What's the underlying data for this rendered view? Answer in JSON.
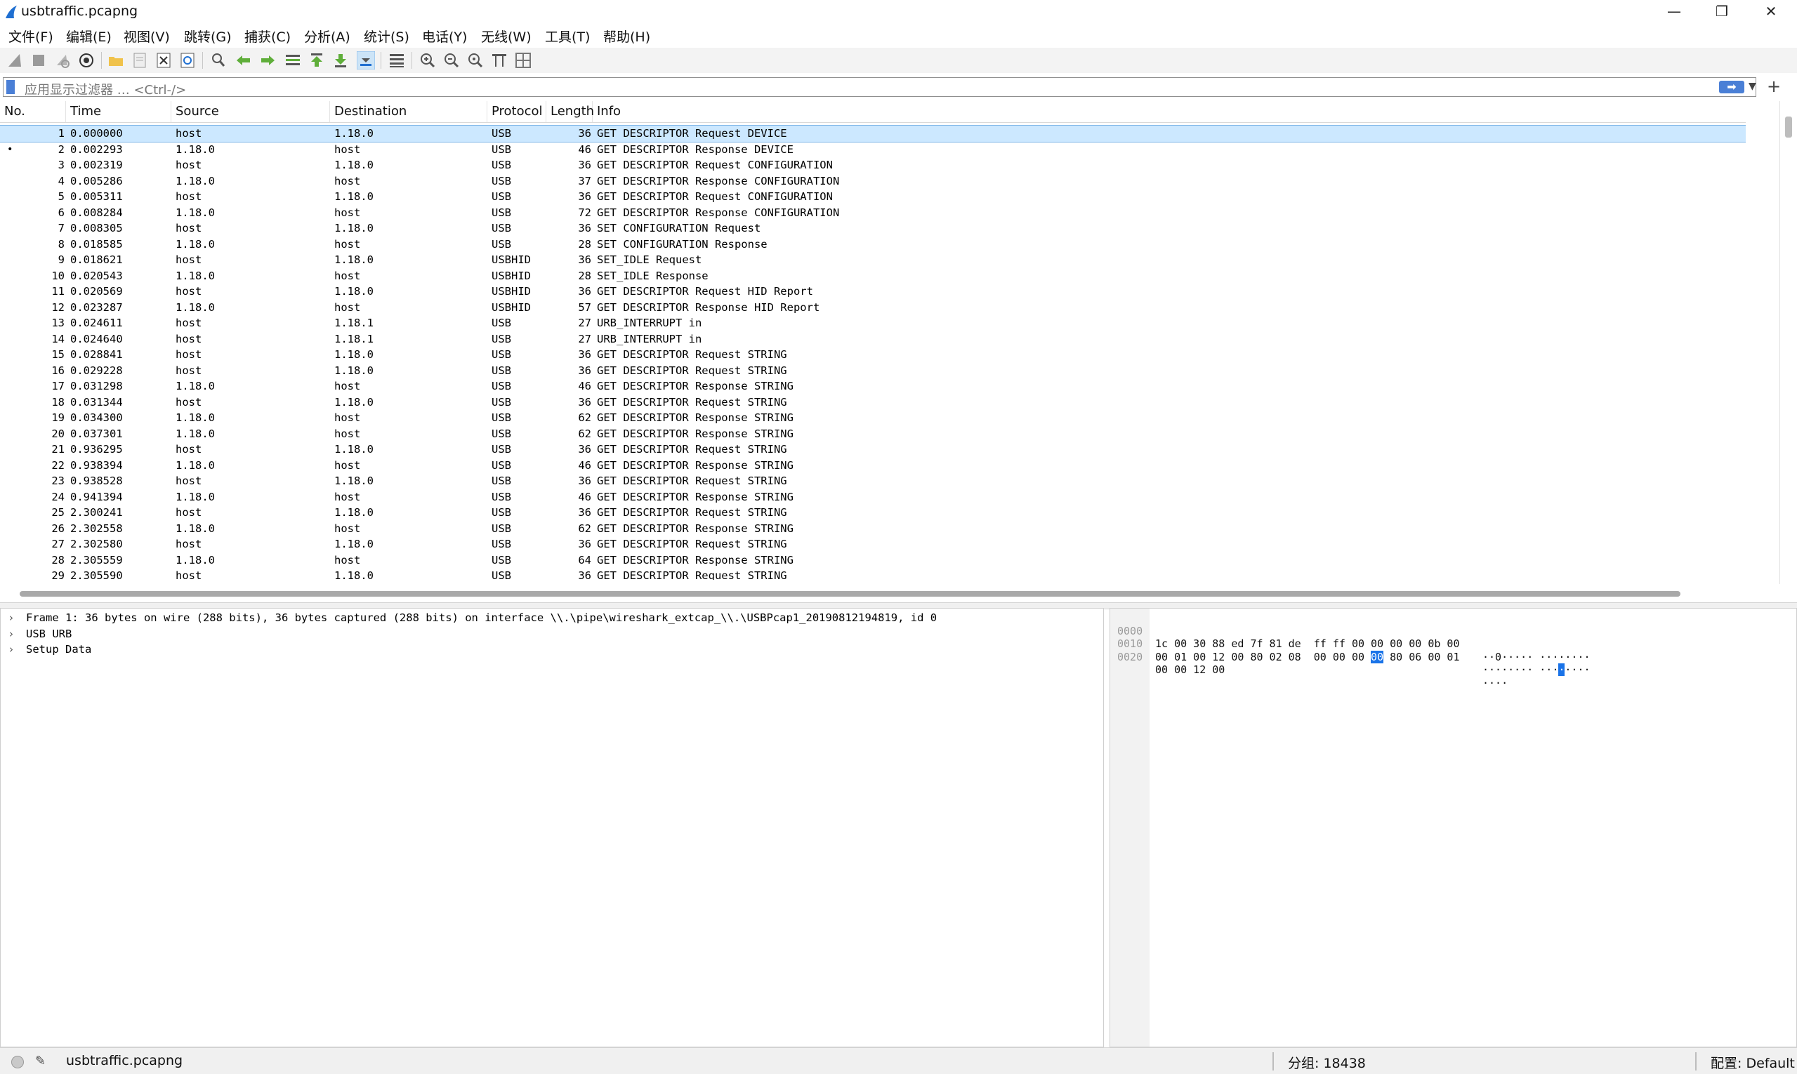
{
  "window": {
    "title": "usbtraffic.pcapng"
  },
  "menu": [
    "文件(F)",
    "编辑(E)",
    "视图(V)",
    "跳转(G)",
    "捕获(C)",
    "分析(A)",
    "统计(S)",
    "电话(Y)",
    "无线(W)",
    "工具(T)",
    "帮助(H)"
  ],
  "toolbar": {
    "icons": [
      "start-capture-icon",
      "stop-capture-icon",
      "restart-capture-icon",
      "capture-options-icon",
      "open-file-icon",
      "save-file-icon",
      "close-file-icon",
      "reload-file-icon",
      "find-packet-icon",
      "go-back-icon",
      "go-forward-icon",
      "go-to-packet-icon",
      "first-packet-icon",
      "last-packet-icon",
      "autoscroll-icon",
      "colorize-icon",
      "zoom-in-icon",
      "zoom-out-icon",
      "zoom-normal-icon",
      "resize-columns-icon",
      "layout-icon"
    ]
  },
  "filter": {
    "placeholder": "应用显示过滤器 … <Ctrl-/>",
    "apply_label": "➡",
    "add_label": "+"
  },
  "packet_list": {
    "columns": [
      "No.",
      "Time",
      "Source",
      "Destination",
      "Protocol",
      "Length",
      "Info"
    ],
    "selected_index": 0,
    "rows": [
      {
        "no": "1",
        "time": "0.000000",
        "src": "host",
        "dst": "1.18.0",
        "proto": "USB",
        "len": "36",
        "info": "GET DESCRIPTOR Request DEVICE"
      },
      {
        "no": "2",
        "time": "0.002293",
        "src": "1.18.0",
        "dst": "host",
        "proto": "USB",
        "len": "46",
        "info": "GET DESCRIPTOR Response DEVICE"
      },
      {
        "no": "3",
        "time": "0.002319",
        "src": "host",
        "dst": "1.18.0",
        "proto": "USB",
        "len": "36",
        "info": "GET DESCRIPTOR Request CONFIGURATION"
      },
      {
        "no": "4",
        "time": "0.005286",
        "src": "1.18.0",
        "dst": "host",
        "proto": "USB",
        "len": "37",
        "info": "GET DESCRIPTOR Response CONFIGURATION"
      },
      {
        "no": "5",
        "time": "0.005311",
        "src": "host",
        "dst": "1.18.0",
        "proto": "USB",
        "len": "36",
        "info": "GET DESCRIPTOR Request CONFIGURATION"
      },
      {
        "no": "6",
        "time": "0.008284",
        "src": "1.18.0",
        "dst": "host",
        "proto": "USB",
        "len": "72",
        "info": "GET DESCRIPTOR Response CONFIGURATION"
      },
      {
        "no": "7",
        "time": "0.008305",
        "src": "host",
        "dst": "1.18.0",
        "proto": "USB",
        "len": "36",
        "info": "SET CONFIGURATION Request"
      },
      {
        "no": "8",
        "time": "0.018585",
        "src": "1.18.0",
        "dst": "host",
        "proto": "USB",
        "len": "28",
        "info": "SET CONFIGURATION Response"
      },
      {
        "no": "9",
        "time": "0.018621",
        "src": "host",
        "dst": "1.18.0",
        "proto": "USBHID",
        "len": "36",
        "info": "SET_IDLE Request"
      },
      {
        "no": "10",
        "time": "0.020543",
        "src": "1.18.0",
        "dst": "host",
        "proto": "USBHID",
        "len": "28",
        "info": "SET_IDLE Response"
      },
      {
        "no": "11",
        "time": "0.020569",
        "src": "host",
        "dst": "1.18.0",
        "proto": "USBHID",
        "len": "36",
        "info": "GET DESCRIPTOR Request HID Report"
      },
      {
        "no": "12",
        "time": "0.023287",
        "src": "1.18.0",
        "dst": "host",
        "proto": "USBHID",
        "len": "57",
        "info": "GET DESCRIPTOR Response HID Report"
      },
      {
        "no": "13",
        "time": "0.024611",
        "src": "host",
        "dst": "1.18.1",
        "proto": "USB",
        "len": "27",
        "info": "URB_INTERRUPT in"
      },
      {
        "no": "14",
        "time": "0.024640",
        "src": "host",
        "dst": "1.18.1",
        "proto": "USB",
        "len": "27",
        "info": "URB_INTERRUPT in"
      },
      {
        "no": "15",
        "time": "0.028841",
        "src": "host",
        "dst": "1.18.0",
        "proto": "USB",
        "len": "36",
        "info": "GET DESCRIPTOR Request STRING"
      },
      {
        "no": "16",
        "time": "0.029228",
        "src": "host",
        "dst": "1.18.0",
        "proto": "USB",
        "len": "36",
        "info": "GET DESCRIPTOR Request STRING"
      },
      {
        "no": "17",
        "time": "0.031298",
        "src": "1.18.0",
        "dst": "host",
        "proto": "USB",
        "len": "46",
        "info": "GET DESCRIPTOR Response STRING"
      },
      {
        "no": "18",
        "time": "0.031344",
        "src": "host",
        "dst": "1.18.0",
        "proto": "USB",
        "len": "36",
        "info": "GET DESCRIPTOR Request STRING"
      },
      {
        "no": "19",
        "time": "0.034300",
        "src": "1.18.0",
        "dst": "host",
        "proto": "USB",
        "len": "62",
        "info": "GET DESCRIPTOR Response STRING"
      },
      {
        "no": "20",
        "time": "0.037301",
        "src": "1.18.0",
        "dst": "host",
        "proto": "USB",
        "len": "62",
        "info": "GET DESCRIPTOR Response STRING"
      },
      {
        "no": "21",
        "time": "0.936295",
        "src": "host",
        "dst": "1.18.0",
        "proto": "USB",
        "len": "36",
        "info": "GET DESCRIPTOR Request STRING"
      },
      {
        "no": "22",
        "time": "0.938394",
        "src": "1.18.0",
        "dst": "host",
        "proto": "USB",
        "len": "46",
        "info": "GET DESCRIPTOR Response STRING"
      },
      {
        "no": "23",
        "time": "0.938528",
        "src": "host",
        "dst": "1.18.0",
        "proto": "USB",
        "len": "36",
        "info": "GET DESCRIPTOR Request STRING"
      },
      {
        "no": "24",
        "time": "0.941394",
        "src": "1.18.0",
        "dst": "host",
        "proto": "USB",
        "len": "46",
        "info": "GET DESCRIPTOR Response STRING"
      },
      {
        "no": "25",
        "time": "2.300241",
        "src": "host",
        "dst": "1.18.0",
        "proto": "USB",
        "len": "36",
        "info": "GET DESCRIPTOR Request STRING"
      },
      {
        "no": "26",
        "time": "2.302558",
        "src": "1.18.0",
        "dst": "host",
        "proto": "USB",
        "len": "62",
        "info": "GET DESCRIPTOR Response STRING"
      },
      {
        "no": "27",
        "time": "2.302580",
        "src": "host",
        "dst": "1.18.0",
        "proto": "USB",
        "len": "36",
        "info": "GET DESCRIPTOR Request STRING"
      },
      {
        "no": "28",
        "time": "2.305559",
        "src": "1.18.0",
        "dst": "host",
        "proto": "USB",
        "len": "64",
        "info": "GET DESCRIPTOR Response STRING"
      },
      {
        "no": "29",
        "time": "2.305590",
        "src": "host",
        "dst": "1.18.0",
        "proto": "USB",
        "len": "36",
        "info": "GET DESCRIPTOR Request STRING"
      }
    ]
  },
  "details": [
    "Frame 1: 36 bytes on wire (288 bits), 36 bytes captured (288 bits) on interface \\\\.\\pipe\\wireshark_extcap_\\\\.\\USBPcap1_20190812194819, id 0",
    "USB URB",
    "Setup Data"
  ],
  "bytes": [
    {
      "offset": "0000",
      "hex": [
        "1c 00 30 88 ed 7f 81 de  ff ff 00 00 00 00 0b 00"
      ],
      "ascii": "··0····· ········"
    },
    {
      "offset": "0010",
      "hex_pre": "00 01 00 12 00 80 02 08  00 00 00 ",
      "hex_hl": "00",
      "hex_post": " 80 06 00 01",
      "ascii_pre": "········ ···",
      "ascii_hl": "·",
      "ascii_post": "····"
    },
    {
      "offset": "0020",
      "hex": [
        "00 00 12 00"
      ],
      "ascii": "····"
    }
  ],
  "status": {
    "file": "usbtraffic.pcapng",
    "packets": "分组: 18438",
    "profile": "配置: Default"
  },
  "colors": {
    "selection": "#cce8ff",
    "byte_highlight": "#1a73e8",
    "accent": "#4a7fd6"
  }
}
